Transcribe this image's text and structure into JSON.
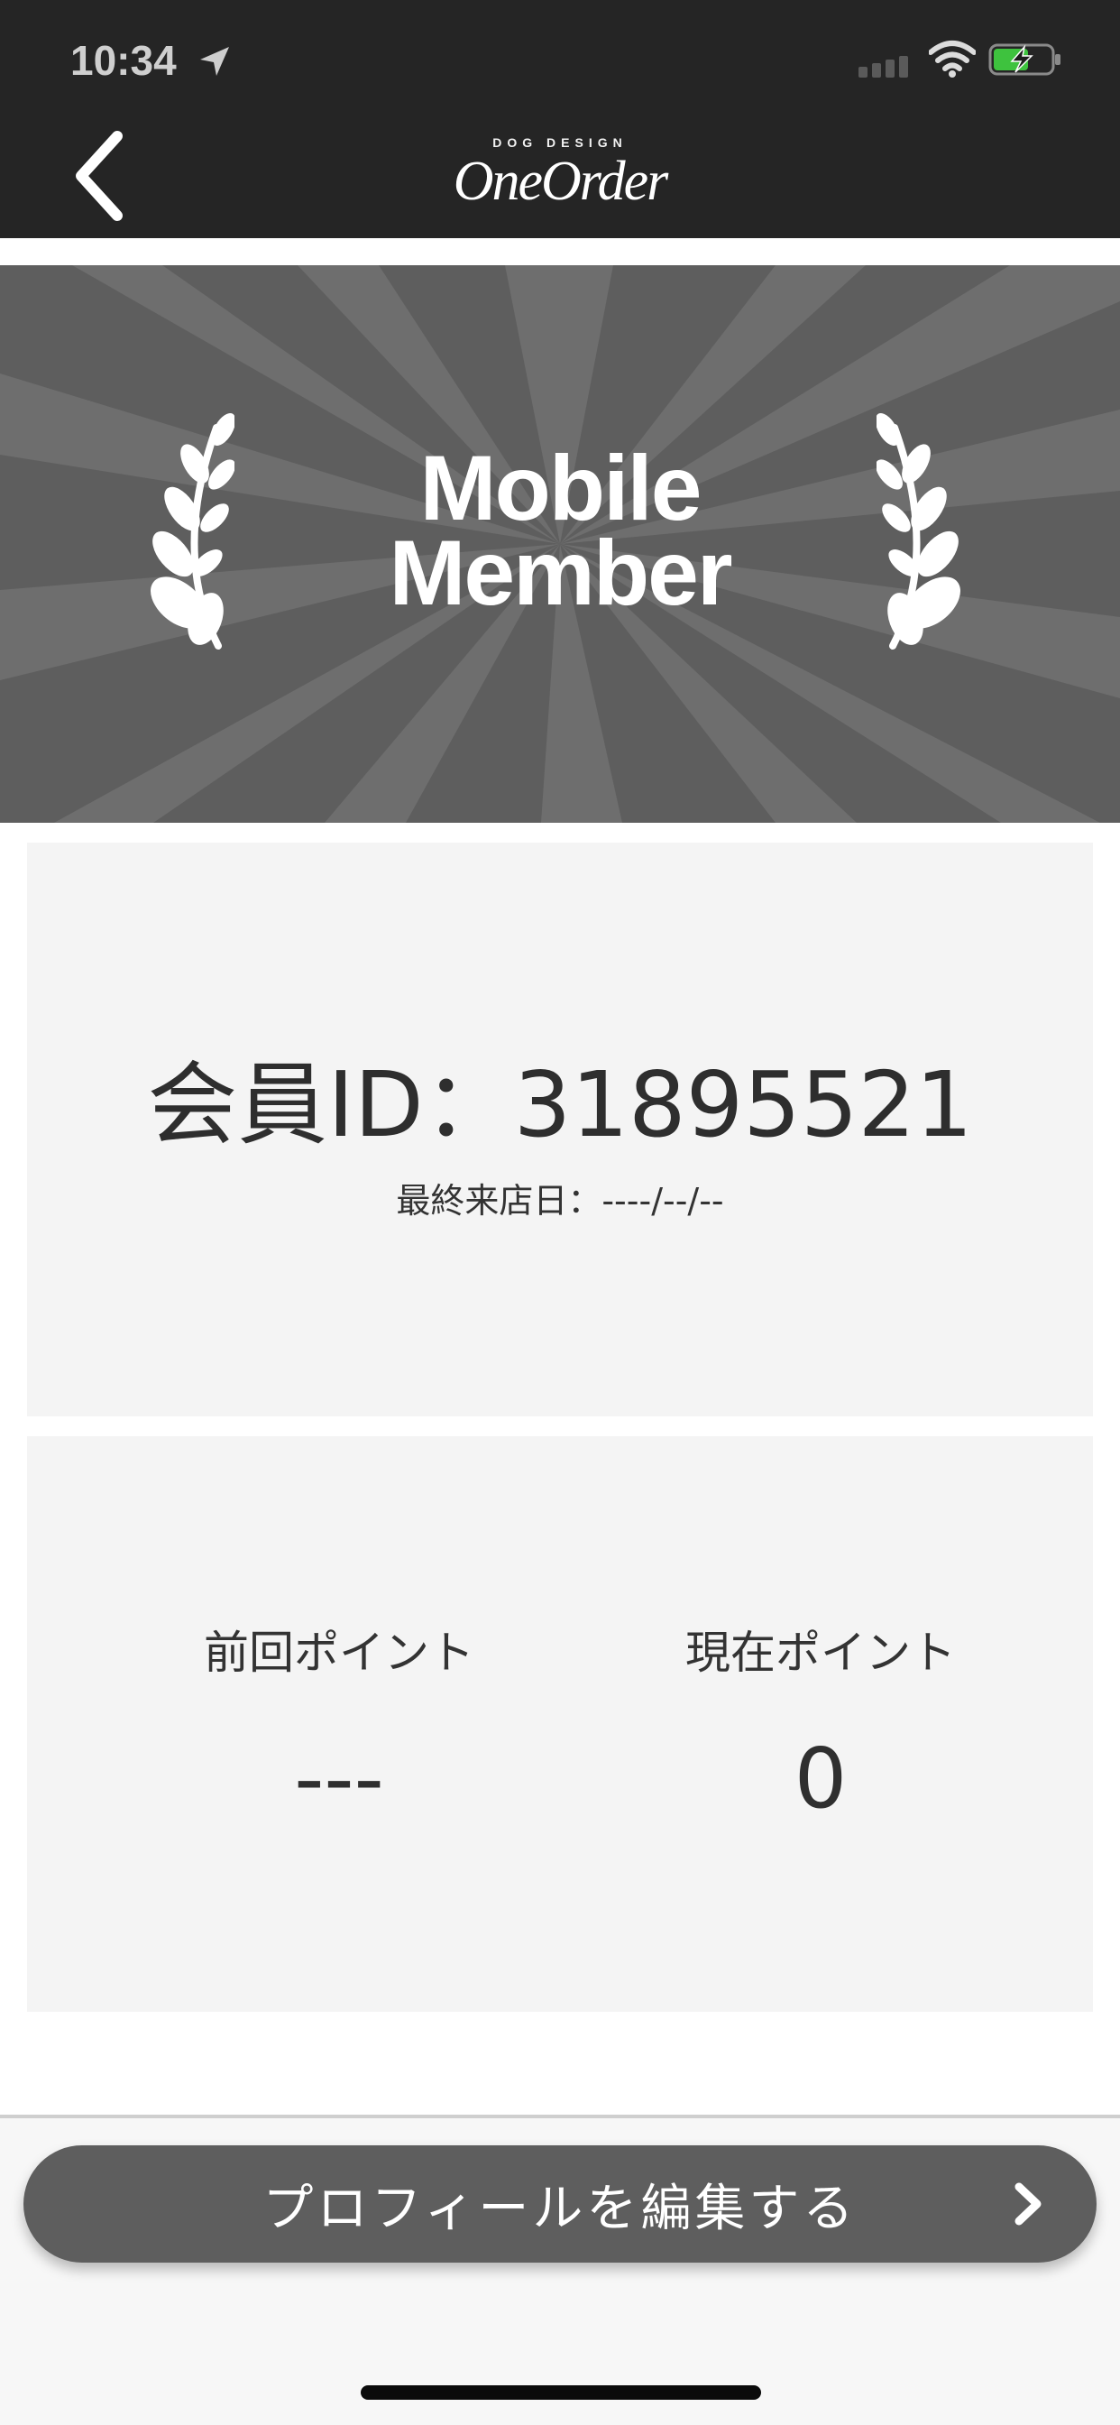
{
  "status_bar": {
    "time": "10:34"
  },
  "header": {
    "brand_sub": "DOG DESIGN",
    "brand_main": "OneOrder"
  },
  "banner": {
    "title_line1": "Mobile",
    "title_line2": "Member"
  },
  "member": {
    "id_text": "会員ID：31895521",
    "last_visit": "最終来店日：----/--/--"
  },
  "points": {
    "previous_label": "前回ポイント",
    "previous_value": "---",
    "current_label": "現在ポイント",
    "current_value": "0"
  },
  "footer": {
    "edit_profile_label": "プロフィールを編集する"
  },
  "colors": {
    "header_bg": "#252525",
    "banner_bg": "#5e5e5e",
    "card_bg": "#f4f4f4",
    "button_bg": "#5e5e5e",
    "battery_charge": "#3ec23e"
  }
}
